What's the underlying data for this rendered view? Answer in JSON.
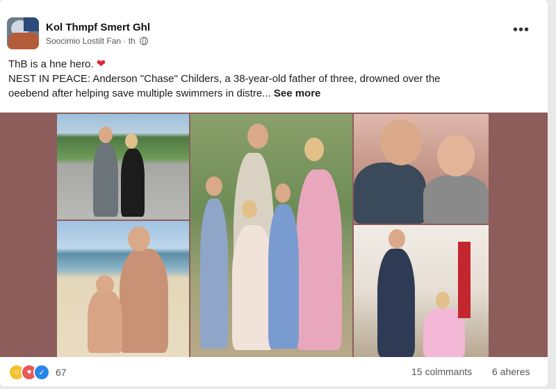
{
  "post": {
    "page_name": "Kol Thmpf Smert Ghl",
    "subtitle": "Soocimio Lostilt Fan · th",
    "line1": "ThB is a hne hero.",
    "heart": "❤",
    "line2": "NEST IN PEACE: Anderson \"Chase\" Childers, a 38-year-old father of three, drowned over the",
    "line3": "oeebend after helping save multiple swimmers in distre...",
    "see_more": "See more",
    "more_icon": "•••"
  },
  "footer": {
    "reaction_icons": [
      "wow-icon",
      "care-icon",
      "like-icon"
    ],
    "reaction_count": "67",
    "comments": "15 colmmants",
    "shares": "6 aheres"
  },
  "colors": {
    "background": "#e9e9ea",
    "card": "#ffffff",
    "media_backdrop": "#8c5d5b",
    "heart": "#e0243a"
  }
}
